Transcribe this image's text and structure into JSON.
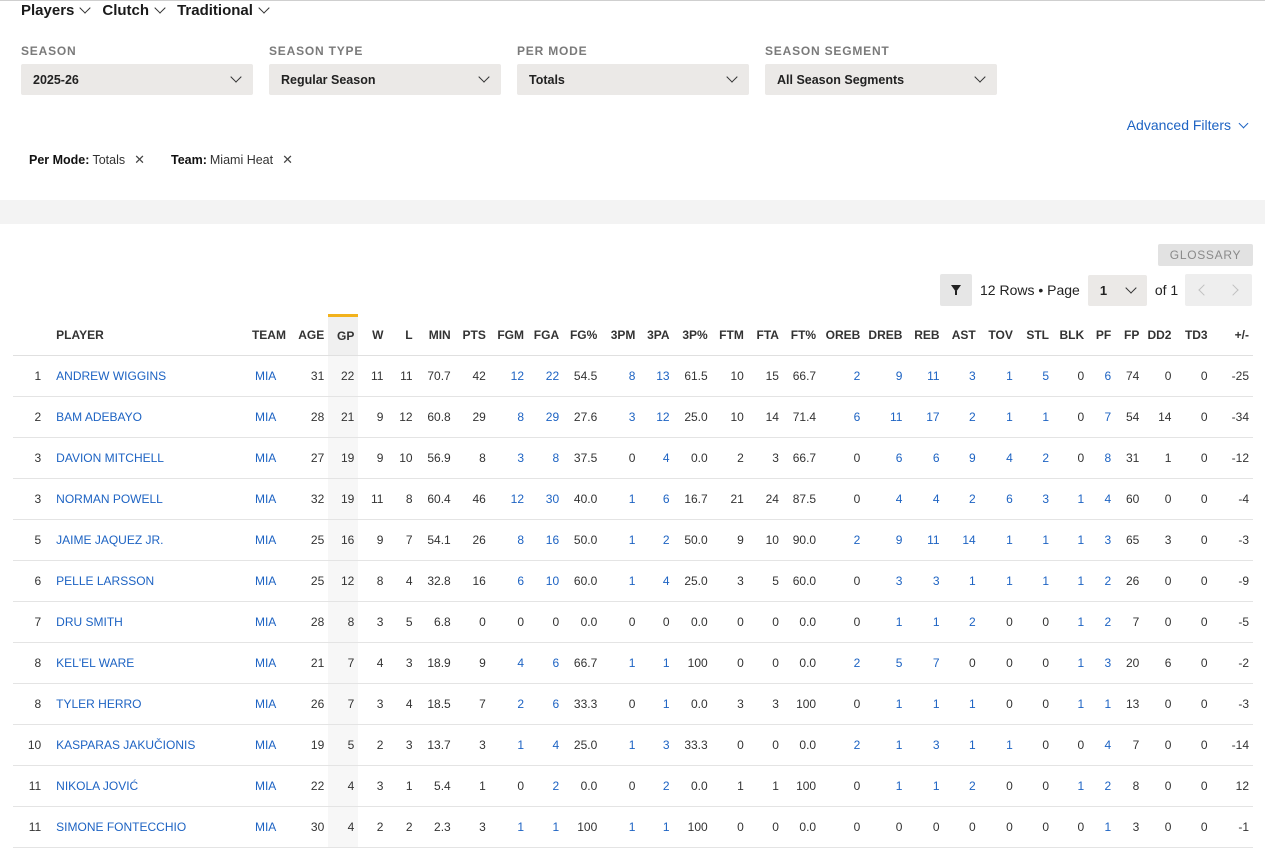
{
  "nav": [
    {
      "label": "Players"
    },
    {
      "label": "Clutch"
    },
    {
      "label": "Traditional"
    }
  ],
  "filters": [
    {
      "label": "SEASON",
      "value": "2025-26"
    },
    {
      "label": "SEASON TYPE",
      "value": "Regular Season"
    },
    {
      "label": "PER MODE",
      "value": "Totals"
    },
    {
      "label": "SEASON SEGMENT",
      "value": "All Season Segments"
    }
  ],
  "advanced_filters_label": "Advanced Filters",
  "active_filters": [
    {
      "key": "Per Mode:",
      "value": "Totals"
    },
    {
      "key": "Team:",
      "value": "Miami Heat"
    }
  ],
  "glossary_label": "GLOSSARY",
  "pagination": {
    "rows_text": "12 Rows • Page",
    "page": "1",
    "of_text": "of 1"
  },
  "table": {
    "columns": [
      "",
      "PLAYER",
      "TEAM",
      "AGE",
      "GP",
      "W",
      "L",
      "MIN",
      "PTS",
      "FGM",
      "FGA",
      "FG%",
      "3PM",
      "3PA",
      "3P%",
      "FTM",
      "FTA",
      "FT%",
      "OREB",
      "DREB",
      "REB",
      "AST",
      "TOV",
      "STL",
      "BLK",
      "PF",
      "FP",
      "DD2",
      "TD3",
      "+/-"
    ],
    "sorted_column": "GP",
    "rows": [
      [
        "1",
        "ANDREW WIGGINS",
        "MIA",
        "31",
        "22",
        "11",
        "11",
        "70.7",
        "42",
        "12",
        "22",
        "54.5",
        "8",
        "13",
        "61.5",
        "10",
        "15",
        "66.7",
        "2",
        "9",
        "11",
        "3",
        "1",
        "5",
        "0",
        "6",
        "74",
        "0",
        "0",
        "-25"
      ],
      [
        "2",
        "BAM ADEBAYO",
        "MIA",
        "28",
        "21",
        "9",
        "12",
        "60.8",
        "29",
        "8",
        "29",
        "27.6",
        "3",
        "12",
        "25.0",
        "10",
        "14",
        "71.4",
        "6",
        "11",
        "17",
        "2",
        "1",
        "1",
        "0",
        "7",
        "54",
        "14",
        "0",
        "-34"
      ],
      [
        "3",
        "DAVION MITCHELL",
        "MIA",
        "27",
        "19",
        "9",
        "10",
        "56.9",
        "8",
        "3",
        "8",
        "37.5",
        "0",
        "4",
        "0.0",
        "2",
        "3",
        "66.7",
        "0",
        "6",
        "6",
        "9",
        "4",
        "2",
        "0",
        "8",
        "31",
        "1",
        "0",
        "-12"
      ],
      [
        "3",
        "NORMAN POWELL",
        "MIA",
        "32",
        "19",
        "11",
        "8",
        "60.4",
        "46",
        "12",
        "30",
        "40.0",
        "1",
        "6",
        "16.7",
        "21",
        "24",
        "87.5",
        "0",
        "4",
        "4",
        "2",
        "6",
        "3",
        "1",
        "4",
        "60",
        "0",
        "0",
        "-4"
      ],
      [
        "5",
        "JAIME JAQUEZ JR.",
        "MIA",
        "25",
        "16",
        "9",
        "7",
        "54.1",
        "26",
        "8",
        "16",
        "50.0",
        "1",
        "2",
        "50.0",
        "9",
        "10",
        "90.0",
        "2",
        "9",
        "11",
        "14",
        "1",
        "1",
        "1",
        "3",
        "65",
        "3",
        "0",
        "-3"
      ],
      [
        "6",
        "PELLE LARSSON",
        "MIA",
        "25",
        "12",
        "8",
        "4",
        "32.8",
        "16",
        "6",
        "10",
        "60.0",
        "1",
        "4",
        "25.0",
        "3",
        "5",
        "60.0",
        "0",
        "3",
        "3",
        "1",
        "1",
        "1",
        "1",
        "2",
        "26",
        "0",
        "0",
        "-9"
      ],
      [
        "7",
        "DRU SMITH",
        "MIA",
        "28",
        "8",
        "3",
        "5",
        "6.8",
        "0",
        "0",
        "0",
        "0.0",
        "0",
        "0",
        "0.0",
        "0",
        "0",
        "0.0",
        "0",
        "1",
        "1",
        "2",
        "0",
        "0",
        "1",
        "2",
        "7",
        "0",
        "0",
        "-5"
      ],
      [
        "8",
        "KEL'EL WARE",
        "MIA",
        "21",
        "7",
        "4",
        "3",
        "18.9",
        "9",
        "4",
        "6",
        "66.7",
        "1",
        "1",
        "100",
        "0",
        "0",
        "0.0",
        "2",
        "5",
        "7",
        "0",
        "0",
        "0",
        "1",
        "3",
        "20",
        "6",
        "0",
        "-2"
      ],
      [
        "8",
        "TYLER HERRO",
        "MIA",
        "26",
        "7",
        "3",
        "4",
        "18.5",
        "7",
        "2",
        "6",
        "33.3",
        "0",
        "1",
        "0.0",
        "3",
        "3",
        "100",
        "0",
        "1",
        "1",
        "1",
        "0",
        "0",
        "1",
        "1",
        "13",
        "0",
        "0",
        "-3"
      ],
      [
        "10",
        "KASPARAS JAKUČIONIS",
        "MIA",
        "19",
        "5",
        "2",
        "3",
        "13.7",
        "3",
        "1",
        "4",
        "25.0",
        "1",
        "3",
        "33.3",
        "0",
        "0",
        "0.0",
        "2",
        "1",
        "3",
        "1",
        "1",
        "0",
        "0",
        "4",
        "7",
        "0",
        "0",
        "-14"
      ],
      [
        "11",
        "NIKOLA JOVIĆ",
        "MIA",
        "22",
        "4",
        "3",
        "1",
        "5.4",
        "1",
        "0",
        "2",
        "0.0",
        "0",
        "2",
        "0.0",
        "1",
        "1",
        "100",
        "0",
        "1",
        "1",
        "2",
        "0",
        "0",
        "1",
        "2",
        "8",
        "0",
        "0",
        "12"
      ],
      [
        "11",
        "SIMONE FONTECCHIO",
        "MIA",
        "30",
        "4",
        "2",
        "2",
        "2.3",
        "3",
        "1",
        "1",
        "100",
        "1",
        "1",
        "100",
        "0",
        "0",
        "0.0",
        "0",
        "0",
        "0",
        "0",
        "0",
        "0",
        "0",
        "1",
        "3",
        "0",
        "0",
        "-1"
      ]
    ]
  }
}
